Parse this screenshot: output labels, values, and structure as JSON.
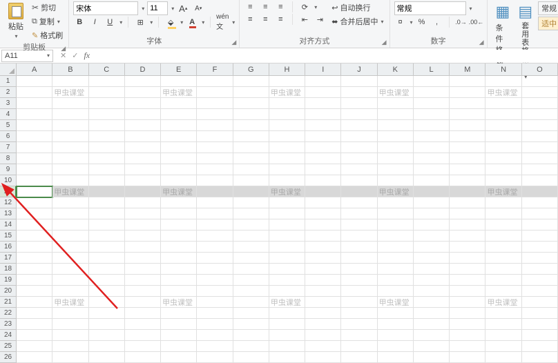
{
  "ribbon": {
    "clipboard": {
      "cut": "剪切",
      "copy": "复制",
      "brush": "格式刷",
      "paste": "粘贴",
      "label": "剪贴板"
    },
    "font": {
      "name": "宋体",
      "size": "11",
      "bold": "B",
      "italic": "I",
      "underline": "U",
      "incA": "A",
      "decA": "A",
      "label": "字体"
    },
    "align": {
      "wrap": "自动换行",
      "merge": "合并后居中",
      "label": "对齐方式"
    },
    "number": {
      "format": "常规",
      "percent": "%",
      "comma": ",",
      "label": "数字"
    },
    "styles": {
      "cond": "条件格式",
      "table": "套用\n表格格式",
      "normal": "常规",
      "good": "适中"
    }
  },
  "namebox": "A11",
  "columns": [
    "A",
    "B",
    "C",
    "D",
    "E",
    "F",
    "G",
    "H",
    "I",
    "J",
    "K",
    "L",
    "M",
    "N",
    "O"
  ],
  "rows": [
    1,
    2,
    3,
    4,
    5,
    6,
    7,
    8,
    9,
    10,
    11,
    12,
    13,
    14,
    15,
    16,
    17,
    18,
    19,
    20,
    21,
    22,
    23,
    24,
    25,
    26
  ],
  "selected_row": 11,
  "watermark_text": "甲虫课堂",
  "watermark_rows": [
    2,
    11,
    21
  ],
  "watermark_cols": [
    "B",
    "E",
    "H",
    "K",
    "N"
  ]
}
